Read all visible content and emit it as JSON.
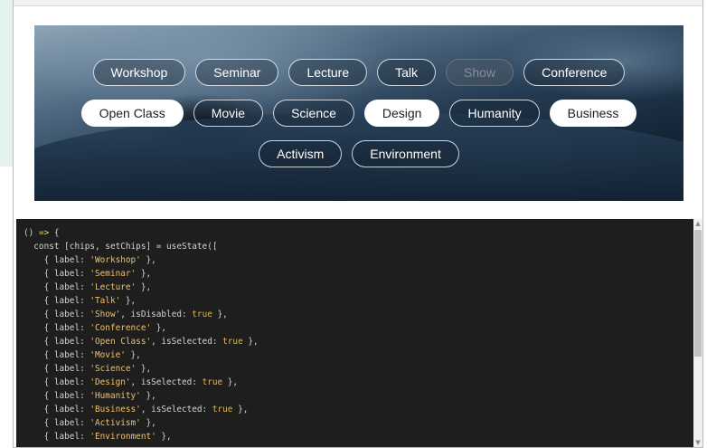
{
  "chips": {
    "row1": [
      {
        "label": "Workshop",
        "state": "default"
      },
      {
        "label": "Seminar",
        "state": "default"
      },
      {
        "label": "Lecture",
        "state": "default"
      },
      {
        "label": "Talk",
        "state": "default"
      },
      {
        "label": "Show",
        "state": "disabled"
      },
      {
        "label": "Conference",
        "state": "default"
      }
    ],
    "row2": [
      {
        "label": "Open Class",
        "state": "selected"
      },
      {
        "label": "Movie",
        "state": "default"
      },
      {
        "label": "Science",
        "state": "default"
      },
      {
        "label": "Design",
        "state": "selected"
      },
      {
        "label": "Humanity",
        "state": "default"
      },
      {
        "label": "Business",
        "state": "selected"
      }
    ],
    "row3": [
      {
        "label": "Activism",
        "state": "default"
      },
      {
        "label": "Environment",
        "state": "default"
      }
    ]
  },
  "code": {
    "lines": [
      "() => {",
      "  const [chips, setChips] = useState([",
      "    { label: 'Workshop' },",
      "    { label: 'Seminar' },",
      "    { label: 'Lecture' },",
      "    { label: 'Talk' },",
      "    { label: 'Show', isDisabled: true },",
      "    { label: 'Conference' },",
      "    { label: 'Open Class', isSelected: true },",
      "    { label: 'Movie' },",
      "    { label: 'Science' },",
      "    { label: 'Design', isSelected: true },",
      "    { label: 'Humanity' },",
      "    { label: 'Business', isSelected: true },",
      "    { label: 'Activism' },",
      "    { label: 'Environment' },"
    ]
  },
  "scrollbar": {
    "up_glyph": "▲",
    "down_glyph": "▼"
  },
  "colors": {
    "code_background": "#1e1e1e",
    "code_text": "#d4d4d4",
    "code_string": "#f0c16b",
    "chip_selected_bg": "#ffffff",
    "chip_border": "#ebf0f5"
  }
}
